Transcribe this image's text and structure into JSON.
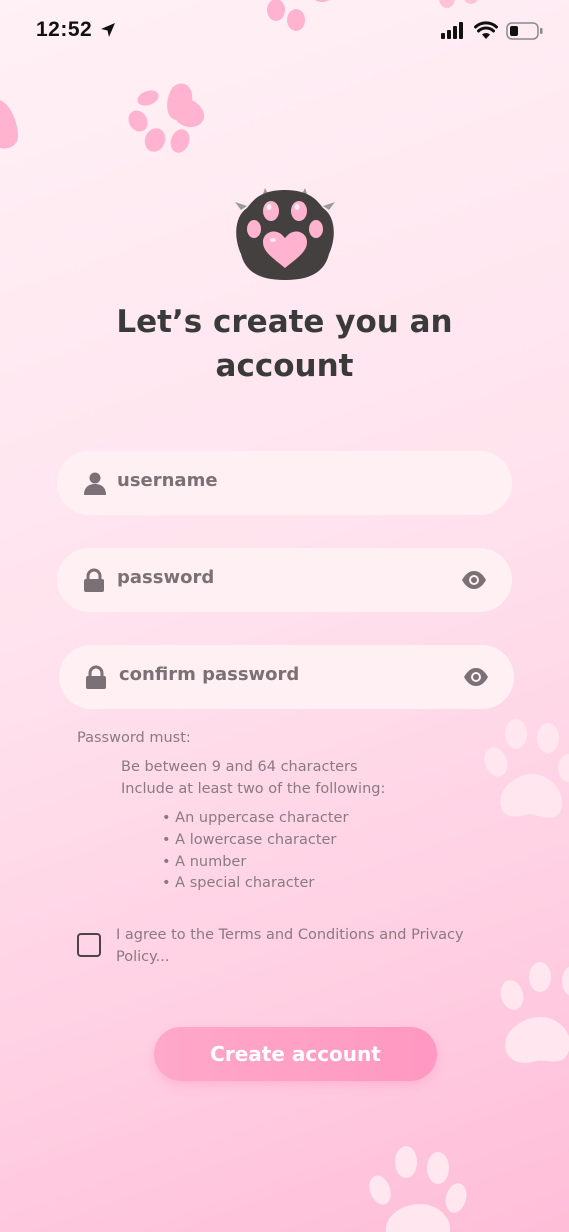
{
  "status_bar": {
    "time": "12:52"
  },
  "title": {
    "line1": "Let’s create you an",
    "line2": "account"
  },
  "fields": {
    "username": {
      "placeholder": "username"
    },
    "password": {
      "placeholder": "password"
    },
    "confirm": {
      "placeholder": "confirm password"
    }
  },
  "rules": {
    "heading": "Password must:",
    "line1": "Be between 9 and 64 characters",
    "line2": "Include at least two of the following:",
    "bullets": [
      "• An uppercase character",
      "• A lowercase character",
      "• A number",
      "• A special character"
    ]
  },
  "agree": {
    "text": "I agree to the Terms and Conditions and Privacy Policy..."
  },
  "buttons": {
    "create": "Create account"
  },
  "colors": {
    "accent": "#ff9ec4",
    "paw_dark": "#454040",
    "paw_pink": "#ffb3cf"
  },
  "icons": [
    "location-arrow-icon",
    "cellular-signal-icon",
    "wifi-icon",
    "battery-icon",
    "user-icon",
    "lock-icon",
    "eye-icon",
    "paw-logo-icon",
    "paw-print-icon"
  ]
}
